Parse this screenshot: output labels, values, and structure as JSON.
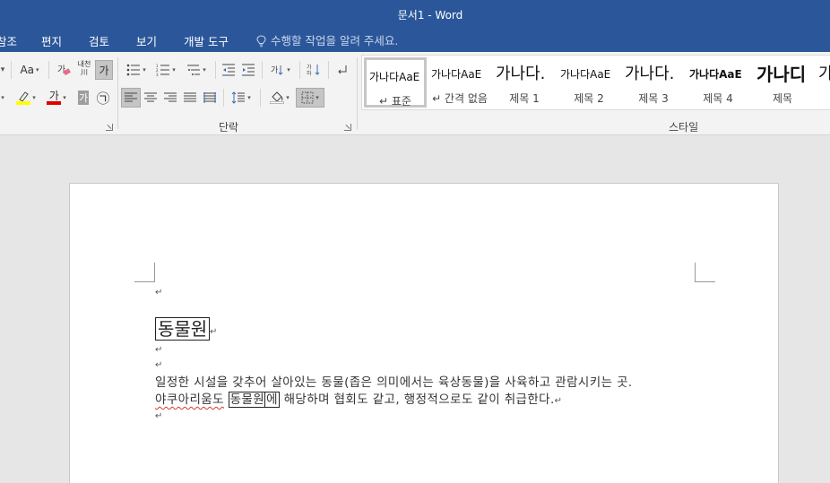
{
  "window": {
    "title": "문서1 - Word"
  },
  "tabs": [
    "참조",
    "편지",
    "검토",
    "보기",
    "개발 도구"
  ],
  "tell_me": {
    "placeholder": "수행할 작업을 알려 주세요."
  },
  "ribbon": {
    "font_group": {
      "change_case": "Aa",
      "phonetic_guide": "내천\n川",
      "char_border": "가",
      "font_color": "가",
      "char_shading": "가",
      "enclose": "㉠"
    },
    "paragraph_group": {
      "label": "단락"
    },
    "styles_group": {
      "label": "스타일",
      "items": [
        {
          "sample": "가나다AaE",
          "name": "↵ 표준",
          "active": true
        },
        {
          "sample": "가나다AaE",
          "name": "↵ 간격 없음"
        },
        {
          "sample": "가나다.",
          "name": "제목 1"
        },
        {
          "sample": "가나다AaE",
          "name": "제목 2"
        },
        {
          "sample": "가나다.",
          "name": "제목 3"
        },
        {
          "sample": "가나다AaE",
          "name": "제목 4"
        },
        {
          "sample": "가나디",
          "name": "제목"
        },
        {
          "sample": "가",
          "name": ""
        }
      ]
    }
  },
  "document": {
    "paragraph_mark": "↵",
    "title": "동물원",
    "body_line1": "일정한 시설을 갖추어 살아있는 동물(좁은 의미에서는 육상동물)을 사육하고 관람시키는 곳.",
    "body_line2_prefix": "야쿠아리움도",
    "body_line2_boxed": "동물원",
    "body_line2_boxed_suffix": "에",
    "body_line2_rest": " 해당하며 협회도 같고, 행정적으로도 같이 취급한다."
  },
  "colors": {
    "titlebar": "#2b579a",
    "ribbon": "#f3f3f3",
    "canvas": "#e6e6e6",
    "highlight": "#ffff00",
    "font_color_red": "#e00000",
    "spellcheck": "#d23a3a"
  }
}
